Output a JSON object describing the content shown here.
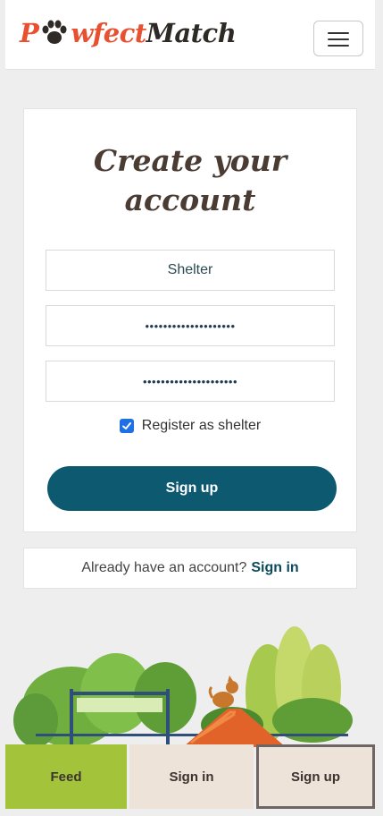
{
  "navbar": {
    "brand_part1": "P",
    "brand_part2": "wfect",
    "brand_part3": "Match",
    "menu_icon": "hamburger-icon"
  },
  "signup_form": {
    "title": "Create your account",
    "username_value": "Shelter",
    "password_value": "••••••••••••••••••••",
    "confirm_password_value": "•••••••••••••••••••••",
    "register_shelter_label": "Register as shelter",
    "register_shelter_checked": true,
    "submit_label": "Sign up"
  },
  "signin_prompt": {
    "text": "Already have an account?",
    "link_label": "Sign in"
  },
  "bottom_nav": {
    "feed_label": "Feed",
    "signin_label": "Sign in",
    "signup_label": "Sign up",
    "active": "Sign up"
  },
  "colors": {
    "brand_orange": "#e8502f",
    "primary_button": "#0d5a70",
    "feed_tab": "#a3c43a",
    "tab_bg": "#ede3d8"
  }
}
